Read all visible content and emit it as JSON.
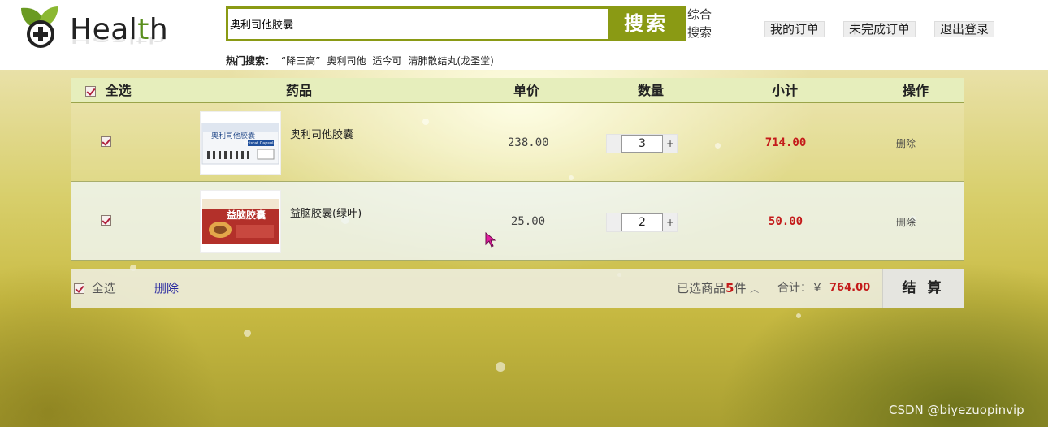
{
  "logo": {
    "text_before": "Heal",
    "text_accent": "t",
    "text_after": "h"
  },
  "search": {
    "value": "奥利司他胶囊",
    "button_label": "搜索",
    "mode_label": "综合搜索"
  },
  "hot_searches": {
    "label": "热门搜索：",
    "items": [
      "“降三高”",
      "奥利司他",
      "适今可",
      "清肺散结丸(龙圣堂)"
    ]
  },
  "top_links": [
    "我的订单",
    "未完成订单",
    "退出登录"
  ],
  "table": {
    "select_all_label": "全选",
    "headers": {
      "product": "药品",
      "unit_price": "单价",
      "quantity": "数量",
      "subtotal": "小计",
      "action": "操作"
    }
  },
  "items": [
    {
      "name": "奥利司他胶囊",
      "price": "238.00",
      "quantity": "3",
      "subtotal": "714.00",
      "delete_label": "删除",
      "thumb_label": "奥利司他胶囊",
      "thumb_sub": "Orlistat Capsules"
    },
    {
      "name": "益脑胶囊(绿叶)",
      "price": "25.00",
      "quantity": "2",
      "subtotal": "50.00",
      "delete_label": "删除",
      "thumb_label": "益脑胶囊"
    }
  ],
  "footer": {
    "select_all_label": "全选",
    "delete_label": "删除",
    "selected_prefix": "已选商品",
    "selected_count": "5",
    "selected_suffix": "件",
    "total_label": "合计：￥",
    "total_value": "764.00",
    "checkout_label": "结 算"
  },
  "watermark": "CSDN @biyezuopinvip",
  "colors": {
    "accent": "#8a9a14",
    "price_red": "#c41a1a",
    "header_bg": "#e6eebc"
  }
}
